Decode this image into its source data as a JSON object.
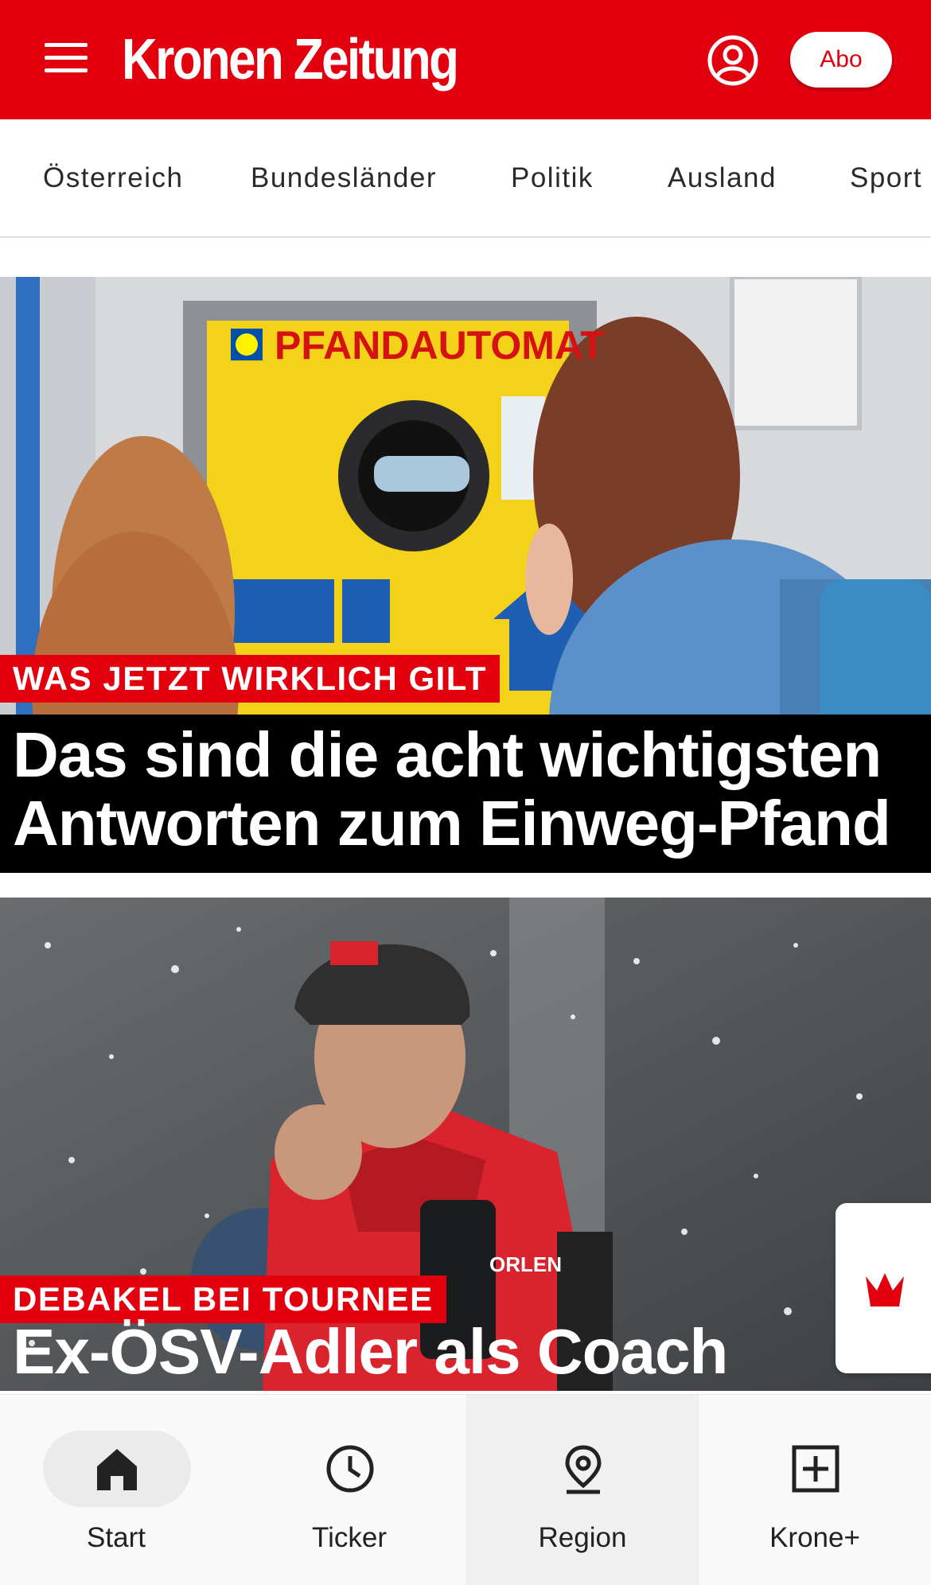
{
  "header": {
    "logo_text": "Kronen Zeitung",
    "abo_label": "Abo",
    "icons": {
      "menu": "hamburger-menu-icon",
      "user": "user-account-icon"
    },
    "brand_color": "#e2000f"
  },
  "categories": [
    "Österreich",
    "Bundesländer",
    "Politik",
    "Ausland",
    "Sport"
  ],
  "articles": [
    {
      "kicker": "WAS JETZT WIRKLICH GILT",
      "headline": "Das sind die acht wichtigsten Antworten zum Einweg-Pfand",
      "image_text": "PFANDAUTOMAT"
    },
    {
      "kicker": "DEBAKEL BEI TOURNEE",
      "headline": "Ex-ÖSV-Adler als Coach",
      "image_text": "ORLEN"
    }
  ],
  "fab": {
    "icon": "krone-crown-icon"
  },
  "bottom_nav": [
    {
      "label": "Start",
      "icon": "home-icon",
      "active": true
    },
    {
      "label": "Ticker",
      "icon": "clock-icon"
    },
    {
      "label": "Region",
      "icon": "location-pin-icon"
    },
    {
      "label": "Krone+",
      "icon": "plus-box-icon"
    }
  ]
}
